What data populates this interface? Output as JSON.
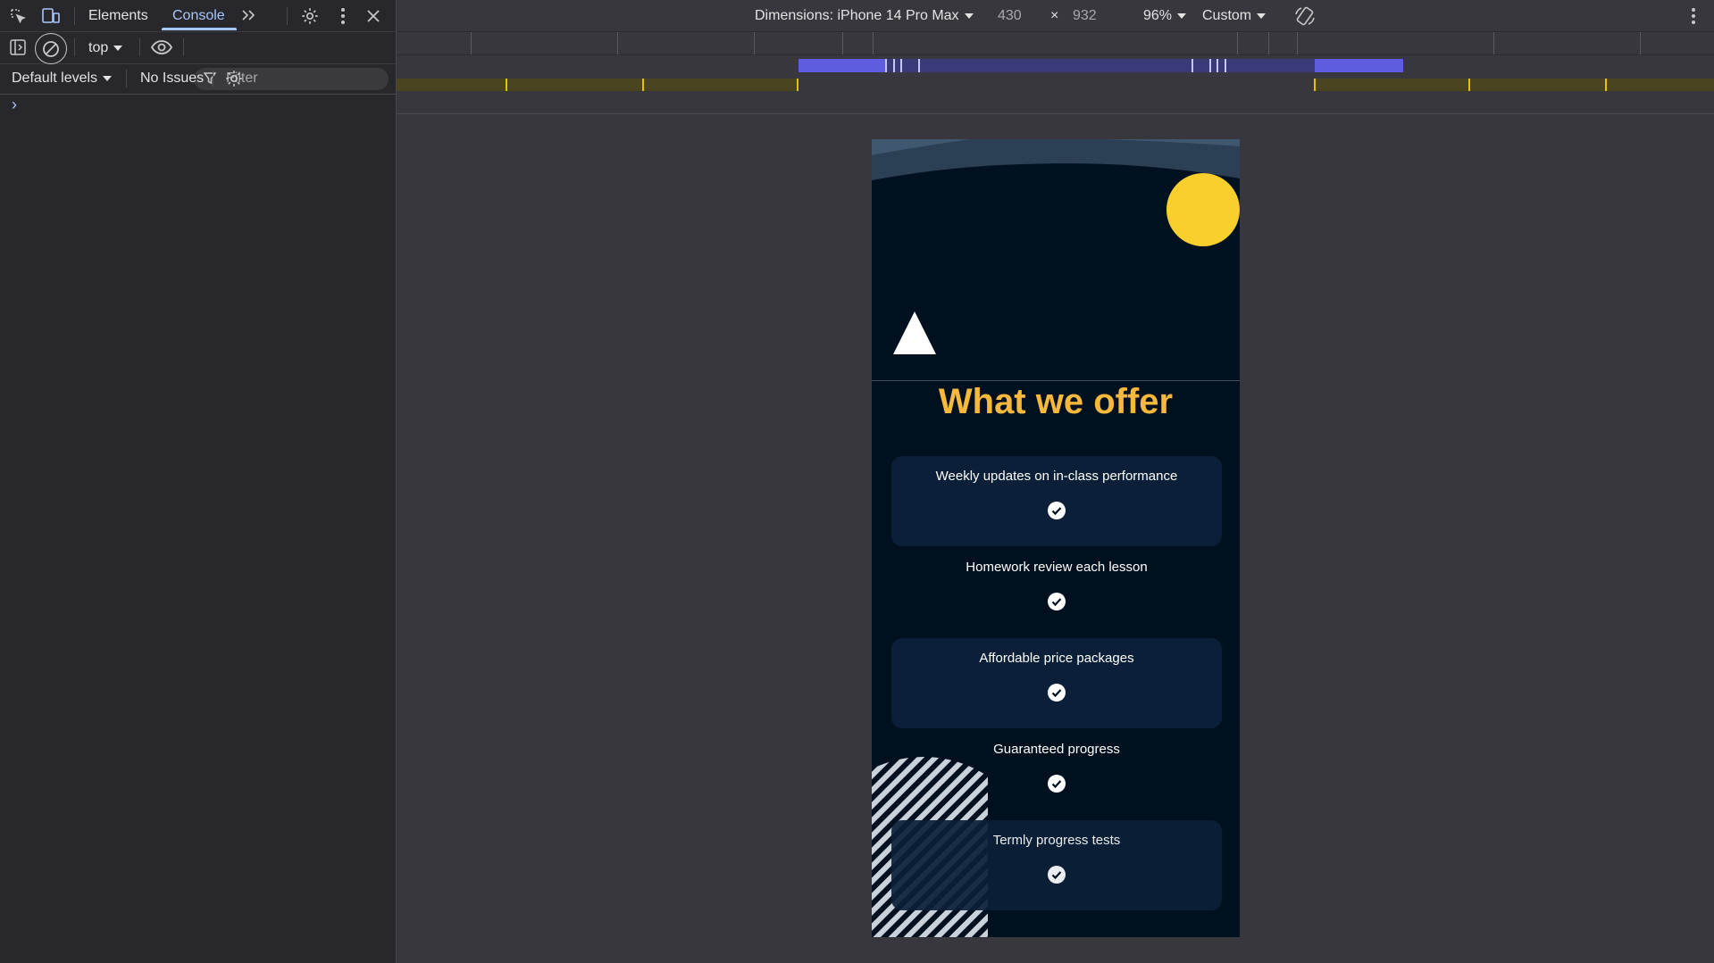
{
  "devtools": {
    "tabs": [
      {
        "label": "Elements",
        "active": false
      },
      {
        "label": "Console",
        "active": true
      }
    ],
    "context_select": "top",
    "filter_placeholder": "Filter",
    "levels_select": "Default levels",
    "issues": "No Issues",
    "prompt_symbol": "›"
  },
  "device_toolbar": {
    "dimensions_label": "Dimensions: iPhone 14 Pro Max",
    "width": "430",
    "times": "×",
    "height": "932",
    "zoom": "96%",
    "throttle": "Custom"
  },
  "page": {
    "heading": "What we offer",
    "offers": [
      {
        "label": "Weekly updates on in-class performance",
        "filled": true
      },
      {
        "label": "Homework review each lesson",
        "filled": false
      },
      {
        "label": "Affordable price packages",
        "filled": true
      },
      {
        "label": "Guaranteed progress",
        "filled": false
      },
      {
        "label": "Termly progress tests",
        "filled": true
      }
    ]
  },
  "colors": {
    "accent_heading": "#f6b93b",
    "sun": "#f9cf2d",
    "page_bg": "#01101f",
    "card_bg": "#0b2038",
    "devtools_accent": "#a8c7fa"
  }
}
